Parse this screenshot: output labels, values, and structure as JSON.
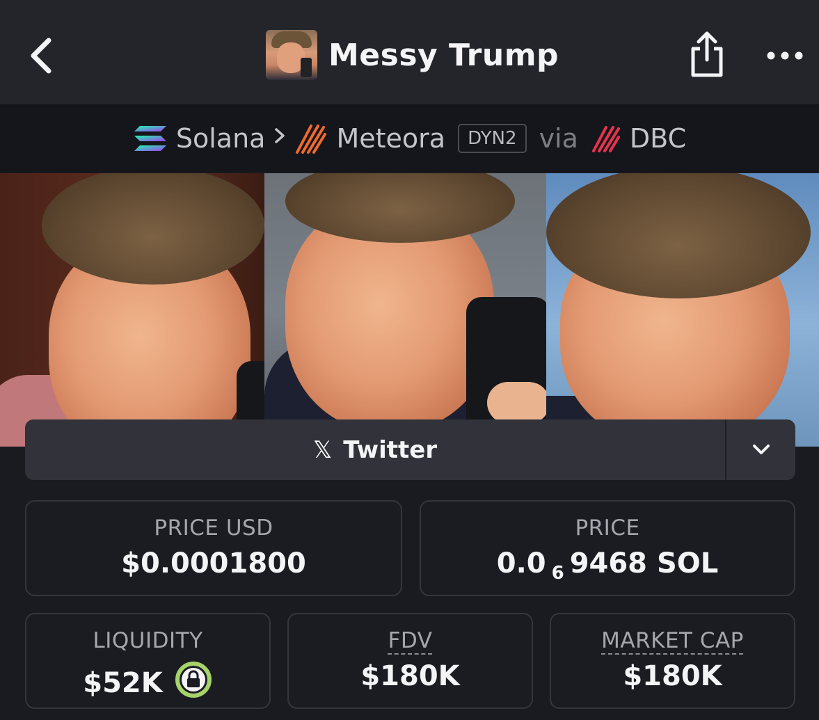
{
  "header": {
    "title": "Messy Trump"
  },
  "chain_path": {
    "chain": "Solana",
    "dex": "Meteora",
    "dex_badge": "DYN2",
    "via": "via",
    "launchpad": "DBC"
  },
  "social": {
    "label": "Twitter"
  },
  "stats": {
    "price_usd_label": "PRICE USD",
    "price_usd_value": "$0.0001800",
    "price_native_label": "PRICE",
    "price_native_prefix": "0.0",
    "price_native_zeros": "6",
    "price_native_suffix": "9468 SOL",
    "liquidity_label": "LIQUIDITY",
    "liquidity_value": "$52K",
    "fdv_label": "FDV",
    "fdv_value": "$180K",
    "mcap_label": "MARKET CAP",
    "mcap_value": "$180K"
  },
  "colors": {
    "background": "#1a1b21",
    "header": "#24252b",
    "lock_accent": "#a6d36a"
  }
}
